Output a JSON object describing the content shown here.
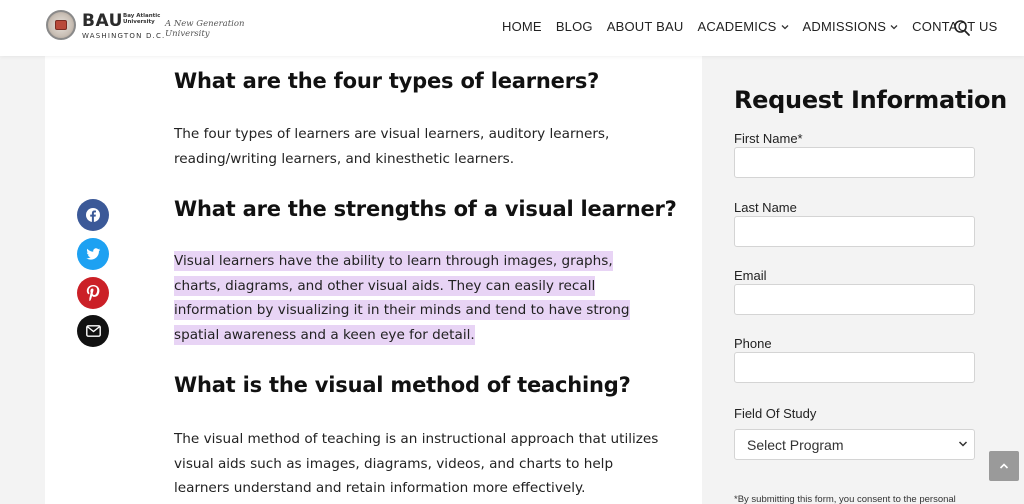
{
  "header": {
    "logo": {
      "name": "BAU",
      "name_sub": "Bay Atlantic University",
      "location": "WASHINGTON D.C.",
      "tagline": "A New Generation University"
    },
    "nav": [
      {
        "label": "HOME",
        "dropdown": false
      },
      {
        "label": "BLOG",
        "dropdown": false
      },
      {
        "label": "ABOUT BAU",
        "dropdown": false
      },
      {
        "label": "ACADEMICS",
        "dropdown": true
      },
      {
        "label": "ADMISSIONS",
        "dropdown": true
      },
      {
        "label": "CONTACT US",
        "dropdown": false
      }
    ]
  },
  "article": {
    "sections": [
      {
        "heading": "What are the four types of learners?",
        "body": "The four types of learners are visual learners, auditory learners, reading/writing learners, and kinesthetic learners."
      },
      {
        "heading": "What are the strengths of a visual learner?",
        "body": "Visual learners have the ability to learn through images, graphs, charts, diagrams, and other visual aids. They can easily recall information by visualizing it in their minds and tend to have strong spatial awareness and a keen eye for detail."
      },
      {
        "heading": "What is the visual method of teaching?",
        "body": "The visual method of teaching is an instructional approach that utilizes visual aids such as images, diagrams, videos, and charts to help learners understand and retain information more effectively."
      }
    ]
  },
  "share": [
    {
      "icon": "facebook-icon",
      "color": "#3b5998"
    },
    {
      "icon": "twitter-icon",
      "color": "#1da1f2"
    },
    {
      "icon": "pinterest-icon",
      "color": "#cb2027"
    },
    {
      "icon": "email-icon",
      "color": "#111111"
    }
  ],
  "sidebar": {
    "title": "Request Information",
    "fields": {
      "first_name": {
        "label": "First Name*",
        "value": ""
      },
      "last_name": {
        "label": "Last Name",
        "value": ""
      },
      "email": {
        "label": "Email",
        "value": ""
      },
      "phone": {
        "label": "Phone",
        "value": ""
      },
      "field_of_study": {
        "label": "Field Of Study",
        "selected": "Select Program"
      }
    },
    "consent": "*By submitting this form, you consent to the personal"
  },
  "colors": {
    "highlight": "#e8d4f5",
    "back_to_top": "#9a9a9a"
  }
}
